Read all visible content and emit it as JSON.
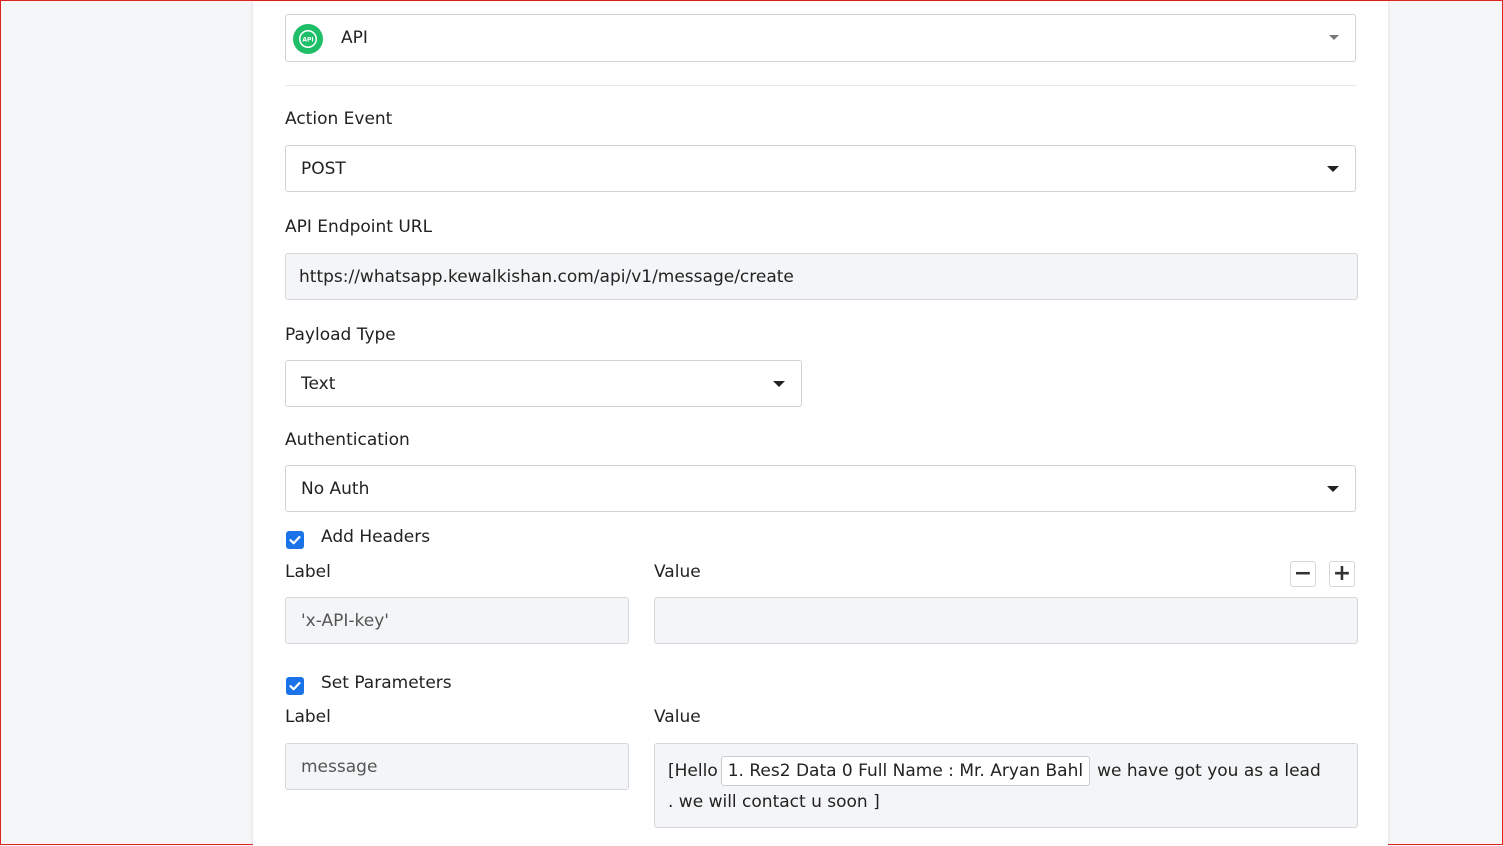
{
  "app_select": {
    "value": "API",
    "icon": "api-icon",
    "icon_text": "API",
    "icon_color": "#1fbf6a"
  },
  "action_event": {
    "label": "Action Event",
    "value": "POST"
  },
  "endpoint": {
    "label": "API Endpoint URL",
    "value": "https://whatsapp.kewalkishan.com/api/v1/message/create"
  },
  "payload_type": {
    "label": "Payload Type",
    "value": "Text"
  },
  "authentication": {
    "label": "Authentication",
    "value": "No Auth"
  },
  "headers": {
    "checkbox_label": "Add Headers",
    "checked": true,
    "label_header": "Label",
    "value_header": "Value",
    "rows": [
      {
        "label": "'x-API-key'",
        "value": ""
      }
    ],
    "remove_icon": "minus-icon",
    "add_icon": "plus-icon"
  },
  "parameters": {
    "checkbox_label": "Set Parameters",
    "checked": true,
    "label_header": "Label",
    "value_header": "Value",
    "rows": [
      {
        "label": "message",
        "value_prefix": "[Hello",
        "value_chip": "1. Res2 Data 0 Full Name : Mr. Aryan Bahl",
        "value_suffix_line1": "we have got you as a lead",
        "value_suffix_line2": ". we will contact u soon ]"
      }
    ]
  },
  "colors": {
    "accent": "#1a73e8",
    "border_frame": "#e0211d"
  }
}
